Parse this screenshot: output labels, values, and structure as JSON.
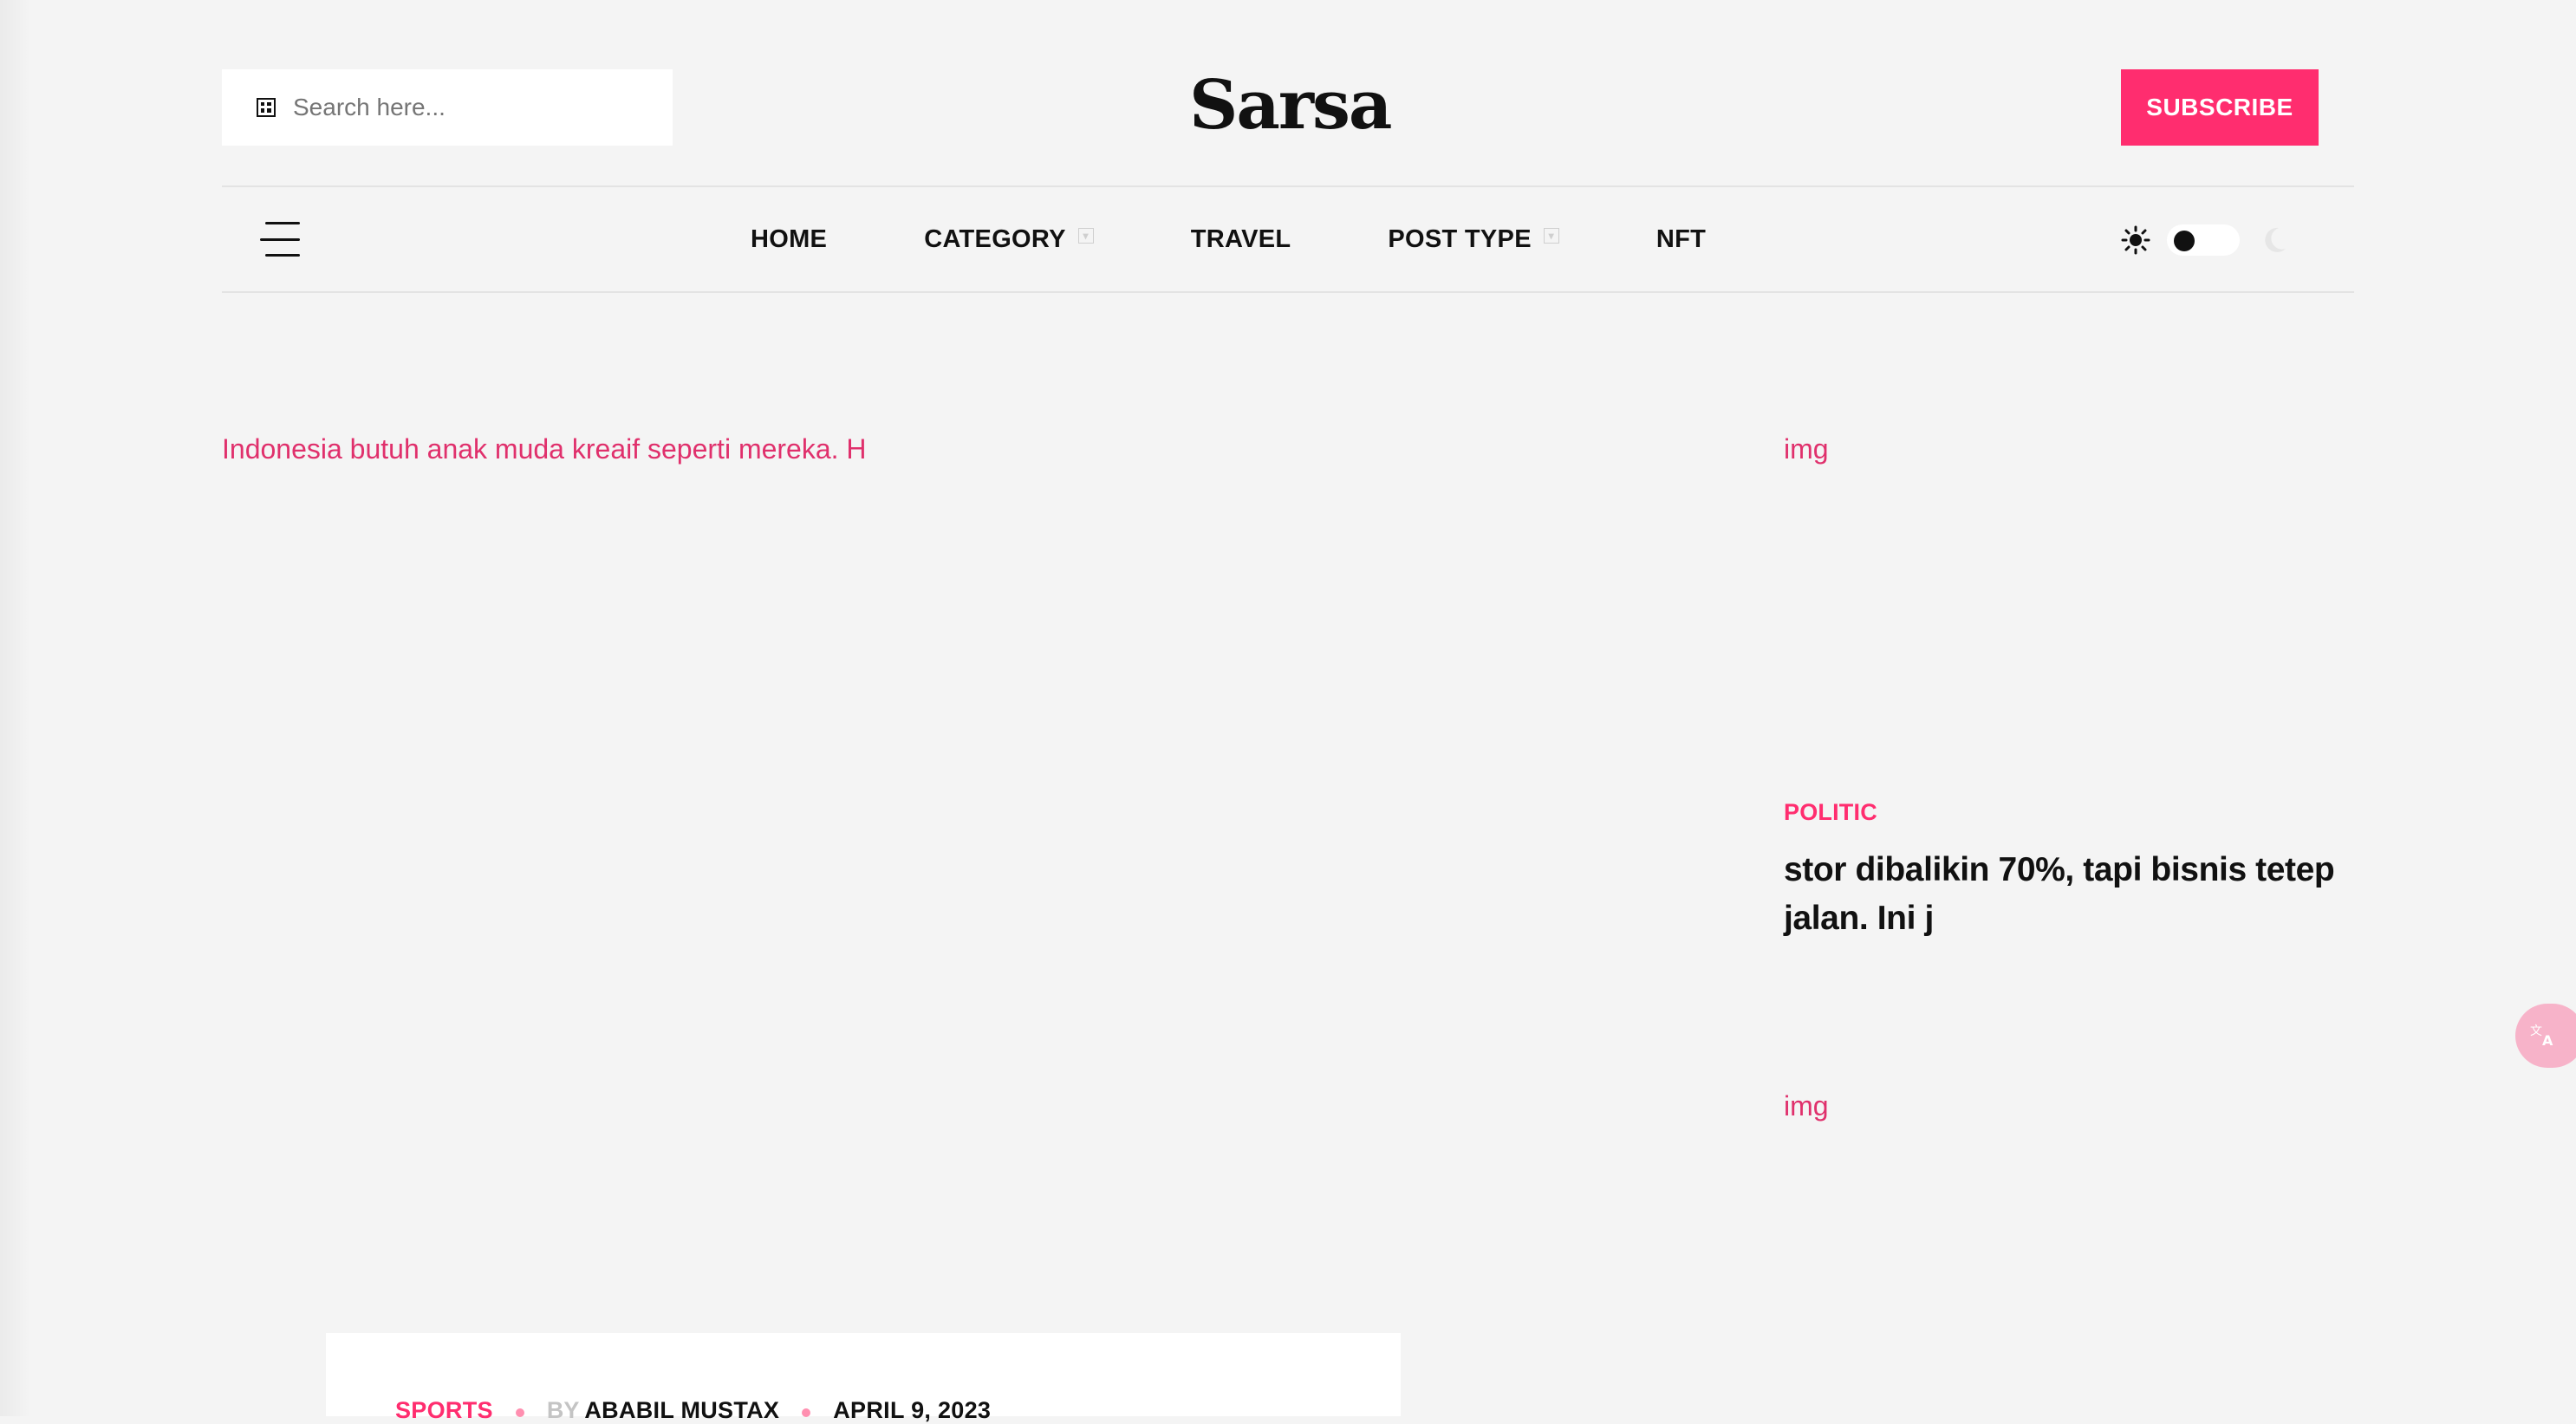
{
  "colors": {
    "accent": "#ff2d6f",
    "background": "#f4f4f4",
    "text": "#111111"
  },
  "header": {
    "search": {
      "placeholder": "Search here...",
      "icon": "search-icon"
    },
    "logo": "Sarsa",
    "subscribe_label": "SUBSCRIBE"
  },
  "nav": {
    "items": [
      {
        "label": "HOME",
        "has_dropdown": false
      },
      {
        "label": "CATEGORY",
        "has_dropdown": true
      },
      {
        "label": "TRAVEL",
        "has_dropdown": false
      },
      {
        "label": "POST TYPE",
        "has_dropdown": true
      },
      {
        "label": "NFT",
        "has_dropdown": false
      }
    ],
    "theme": {
      "current": "light",
      "icons": [
        "sun-icon",
        "moon-icon"
      ]
    }
  },
  "main": {
    "hero_link": "Indonesia butuh anak muda kreaif seperti mereka. H",
    "post_meta": {
      "category": "SPORTS",
      "by_label": "BY",
      "author": "ABABIL MUSTAX",
      "date": "APRIL 9, 2023"
    }
  },
  "sidebar": {
    "img_placeholder_1": "img",
    "category": "POLITIC",
    "title": "stor dibalikin 70%, tapi bisnis tetep jalan. Ini j",
    "img_placeholder_2": "img"
  },
  "floating": {
    "translate_icon": "translate-icon"
  }
}
